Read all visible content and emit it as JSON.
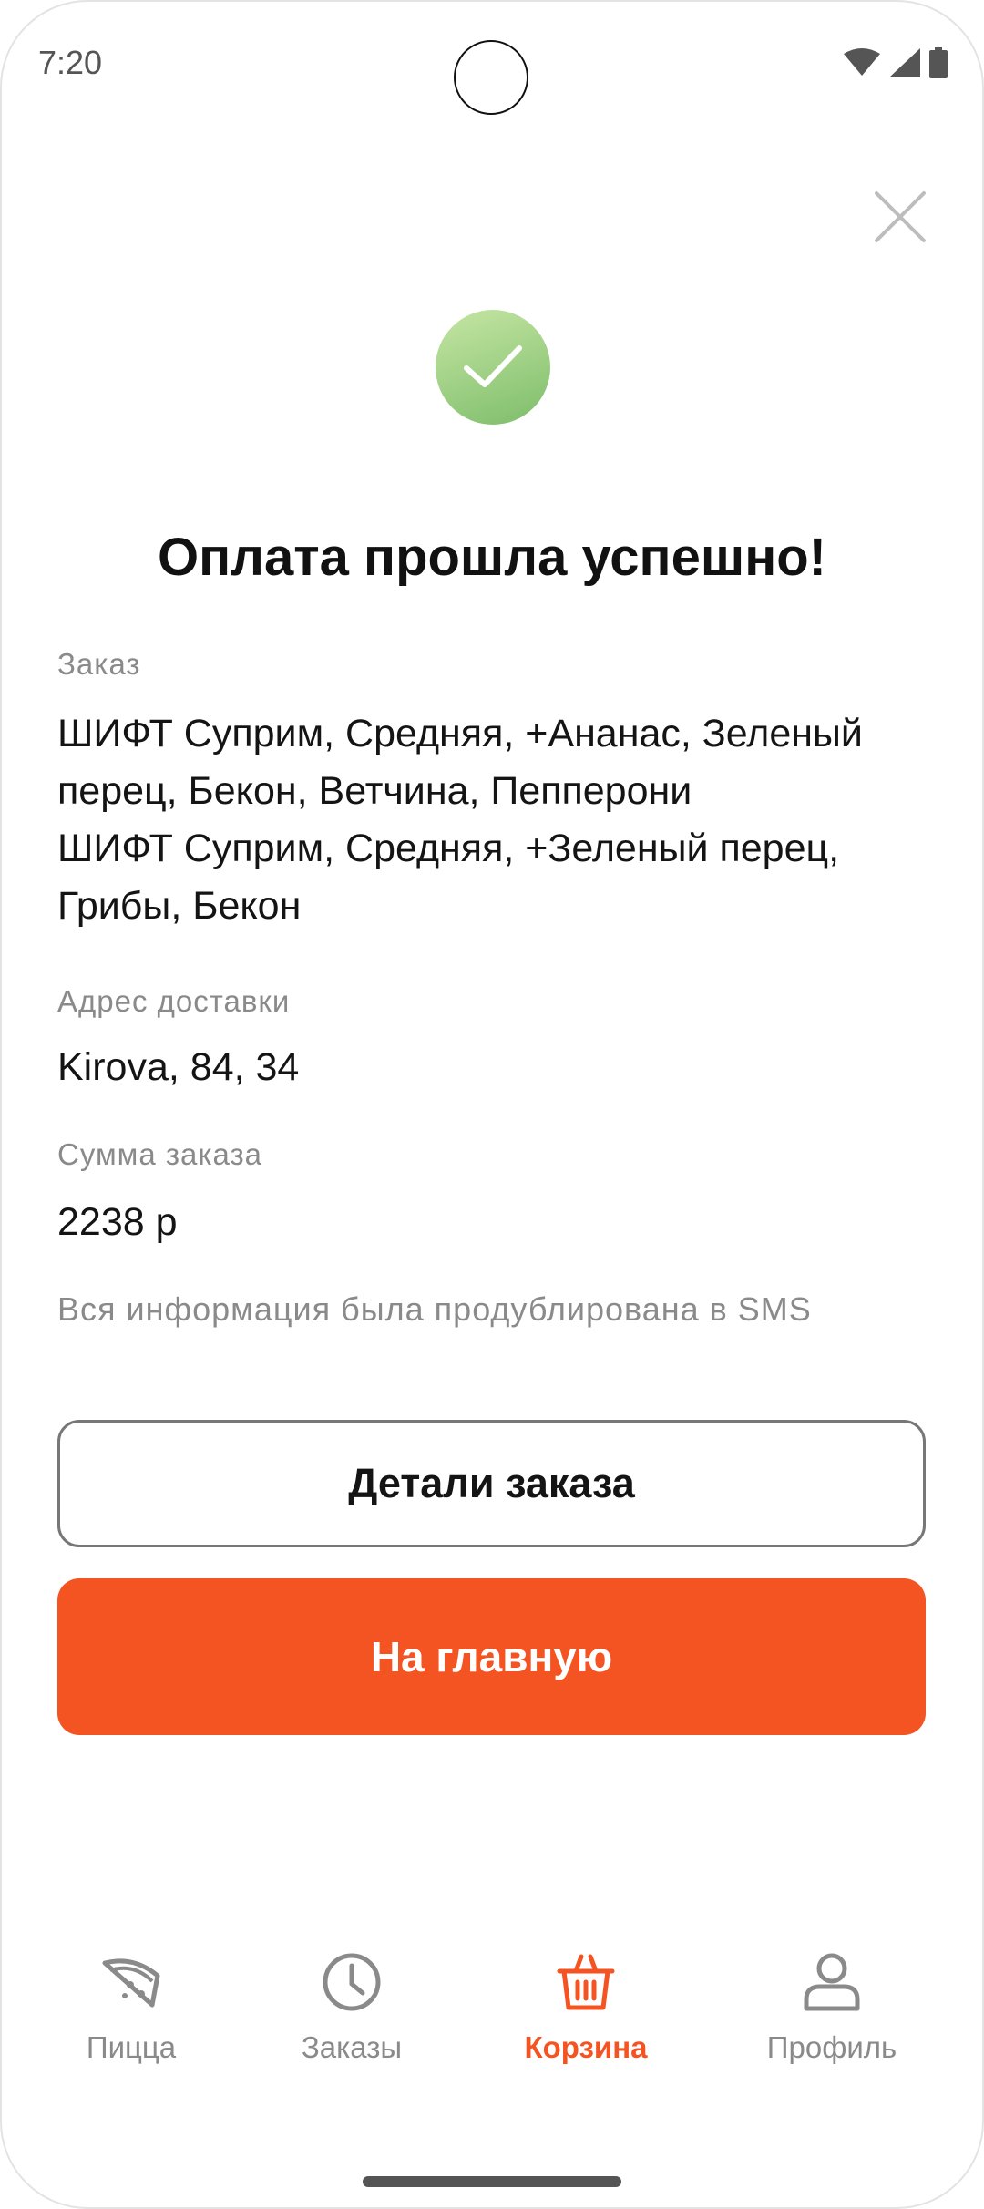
{
  "status_bar": {
    "time": "7:20"
  },
  "title": "Оплата прошла успешно!",
  "order": {
    "label": "Заказ",
    "lines": [
      "ШИФТ Суприм, Средняя, +Ананас, Зеленый перец, Бекон, Ветчина, Пепперони",
      "ШИФТ Суприм, Средняя, +Зеленый перец, Грибы, Бекон"
    ]
  },
  "address": {
    "label": "Адрес доставки",
    "value": "Kirova, 84, 34"
  },
  "sum": {
    "label": "Сумма заказа",
    "value": "2238 р"
  },
  "note": "Вся информация была продублирована в SMS",
  "buttons": {
    "details": "Детали заказа",
    "home": "На главную"
  },
  "nav": {
    "items": [
      {
        "label": "Пицца",
        "icon": "pizza-icon"
      },
      {
        "label": "Заказы",
        "icon": "clock-icon"
      },
      {
        "label": "Корзина",
        "icon": "basket-icon",
        "active": true
      },
      {
        "label": "Профиль",
        "icon": "user-icon"
      }
    ]
  },
  "colors": {
    "accent": "#f45322",
    "success": "#8cc677",
    "muted": "#8a8a8a"
  }
}
